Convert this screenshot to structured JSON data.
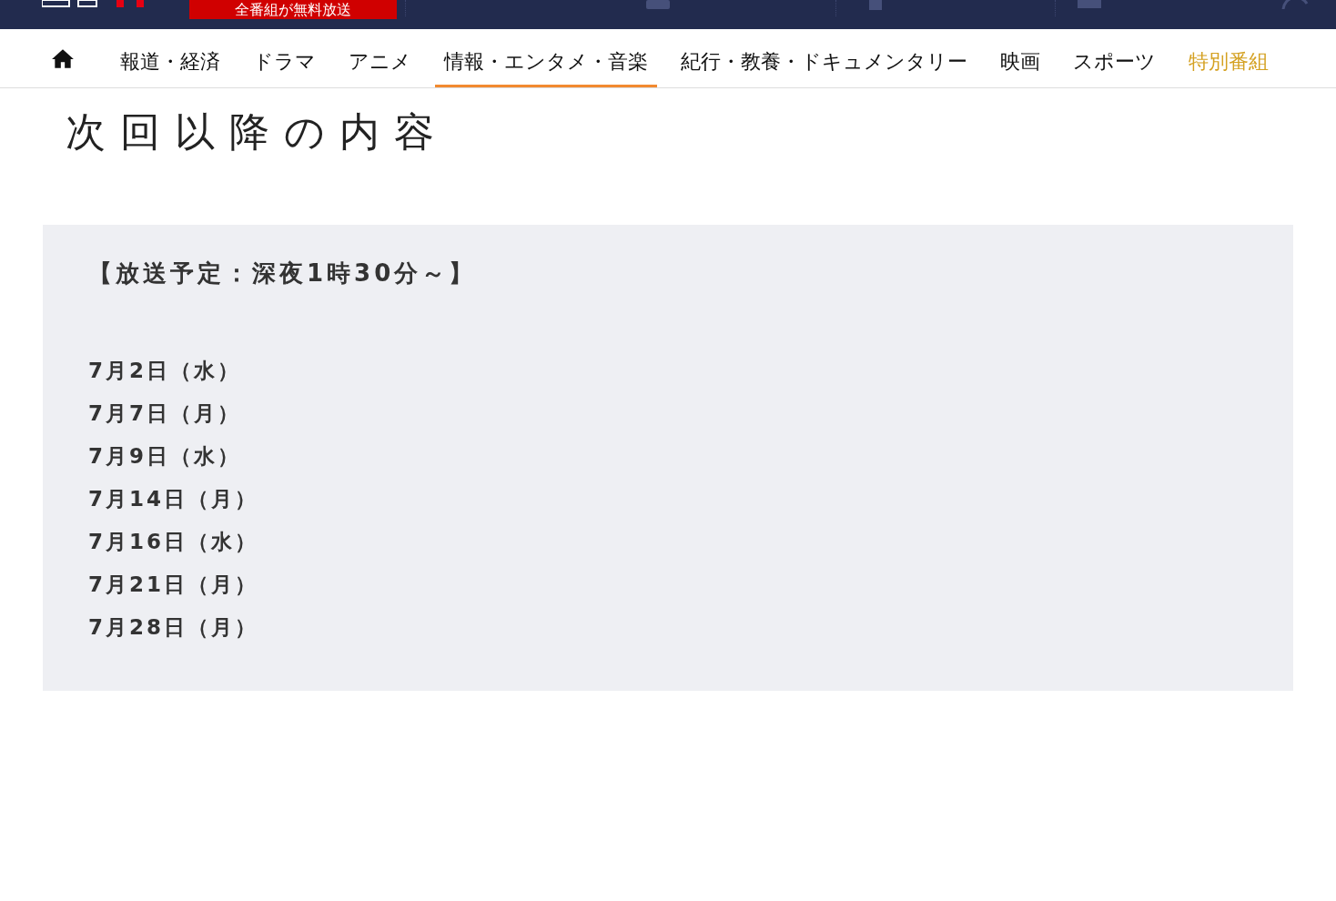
{
  "header": {
    "badge": "全番組が無料放送"
  },
  "nav": {
    "items": [
      {
        "label": "報道・経済",
        "selected": false,
        "kind": "normal"
      },
      {
        "label": "ドラマ",
        "selected": false,
        "kind": "normal"
      },
      {
        "label": "アニメ",
        "selected": false,
        "kind": "normal"
      },
      {
        "label": "情報・エンタメ・音楽",
        "selected": true,
        "kind": "normal"
      },
      {
        "label": "紀行・教養・ドキュメンタリー",
        "selected": false,
        "kind": "normal"
      },
      {
        "label": "映画",
        "selected": false,
        "kind": "normal"
      },
      {
        "label": "スポーツ",
        "selected": false,
        "kind": "normal"
      },
      {
        "label": "特別番組",
        "selected": false,
        "kind": "special"
      }
    ]
  },
  "title": "次回以降の内容",
  "schedule": {
    "heading": "【放送予定：深夜1時30分～】",
    "dates": [
      "7月2日（水）",
      "7月7日（月）",
      "7月9日（水）",
      "7月14日（月）",
      "7月16日（水）",
      "7月21日（月）",
      "7月28日（月）"
    ]
  }
}
